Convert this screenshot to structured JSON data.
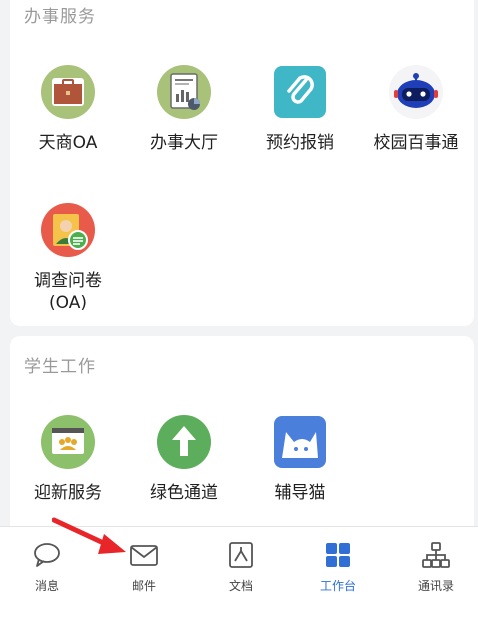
{
  "office_services": {
    "title": "办事服务",
    "apps": [
      {
        "label": "天商OA",
        "icon": "briefcase-icon"
      },
      {
        "label": "办事大厅",
        "icon": "report-icon"
      },
      {
        "label": "预约报销",
        "icon": "paperclip-icon"
      },
      {
        "label": "校园百事通",
        "icon": "robot-icon"
      },
      {
        "label": "调查问卷\n(OA)",
        "icon": "survey-icon"
      }
    ]
  },
  "student_work": {
    "title": "学生工作",
    "apps": [
      {
        "label": "迎新服务",
        "icon": "welcome-icon"
      },
      {
        "label": "绿色通道",
        "icon": "upload-arrow-icon"
      },
      {
        "label": "辅导猫",
        "icon": "cat-icon"
      }
    ]
  },
  "tabbar": {
    "active": "工作台",
    "tabs": [
      {
        "label": "消息",
        "icon": "chat-bubble-icon"
      },
      {
        "label": "邮件",
        "icon": "mail-icon"
      },
      {
        "label": "文档",
        "icon": "document-icon"
      },
      {
        "label": "工作台",
        "icon": "grid-icon"
      },
      {
        "label": "通讯录",
        "icon": "org-chart-icon"
      }
    ]
  },
  "colors": {
    "accent": "#2f6fd6",
    "annotation_arrow": "#e8262a"
  }
}
